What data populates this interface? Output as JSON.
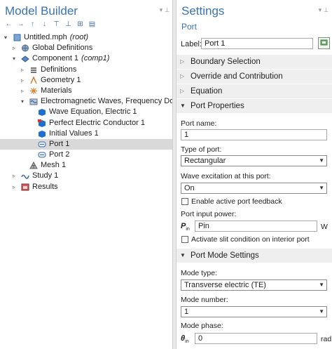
{
  "left_panel": {
    "title": "Model Builder",
    "tree": [
      {
        "label": "Untitled.mph",
        "suffix": "(root)",
        "icon": "file-icon",
        "exp": "▾",
        "level": 0
      },
      {
        "label": "Global Definitions",
        "suffix": "",
        "icon": "globe-icon",
        "exp": "▹",
        "level": 1
      },
      {
        "label": "Component 1",
        "suffix": "(comp1)",
        "icon": "component-icon",
        "exp": "▾",
        "level": 1
      },
      {
        "label": "Definitions",
        "suffix": "",
        "icon": "definitions-icon",
        "exp": "▹",
        "level": 2
      },
      {
        "label": "Geometry 1",
        "suffix": "",
        "icon": "geometry-icon",
        "exp": "▹",
        "level": 2
      },
      {
        "label": "Materials",
        "suffix": "",
        "icon": "materials-icon",
        "exp": "▹",
        "level": 2
      },
      {
        "label": "Electromagnetic Waves, Frequency Domain",
        "suffix": "",
        "icon": "emw-physics-icon",
        "exp": "▾",
        "level": 2
      },
      {
        "label": "Wave Equation, Electric 1",
        "suffix": "",
        "icon": "wave-equation-icon",
        "exp": "",
        "level": 3
      },
      {
        "label": "Perfect Electric Conductor 1",
        "suffix": "",
        "icon": "pec-icon",
        "exp": "",
        "level": 3
      },
      {
        "label": "Initial Values 1",
        "suffix": "",
        "icon": "initial-values-icon",
        "exp": "",
        "level": 3
      },
      {
        "label": "Port 1",
        "suffix": "",
        "icon": "port-icon",
        "exp": "",
        "level": 3,
        "selected": true
      },
      {
        "label": "Port 2",
        "suffix": "",
        "icon": "port-icon",
        "exp": "",
        "level": 3
      },
      {
        "label": "Mesh 1",
        "suffix": "",
        "icon": "mesh-icon",
        "exp": "",
        "level": 2
      },
      {
        "label": "Study 1",
        "suffix": "",
        "icon": "study-icon",
        "exp": "▹",
        "level": 1
      },
      {
        "label": "Results",
        "suffix": "",
        "icon": "results-icon",
        "exp": "▹",
        "level": 1
      }
    ]
  },
  "right_panel": {
    "title": "Settings",
    "subtitle": "Port",
    "label_caption": "Label:",
    "label_value": "Port 1",
    "sections": {
      "boundary": "Boundary Selection",
      "override": "Override and Contribution",
      "equation": "Equation",
      "port_props": "Port Properties",
      "mode_settings": "Port Mode Settings"
    },
    "port_name_label": "Port name:",
    "port_name_value": "1",
    "type_label": "Type of port:",
    "type_value": "Rectangular",
    "wave_label": "Wave excitation at this port:",
    "wave_value": "On",
    "enable_feedback": "Enable active port feedback",
    "input_power_label": "Port input power:",
    "pin_symbol": "P",
    "pin_sub": "in",
    "pin_value": "Pin",
    "pin_unit": "W",
    "slit_condition": "Activate slit condition on interior port",
    "mode_type_label": "Mode type:",
    "mode_type_value": "Transverse electric (TE)",
    "mode_number_label": "Mode number:",
    "mode_number_value": "1",
    "mode_phase_label": "Mode phase:",
    "theta_symbol": "θ",
    "theta_sub": "in",
    "theta_value": "0",
    "theta_unit": "rad"
  }
}
